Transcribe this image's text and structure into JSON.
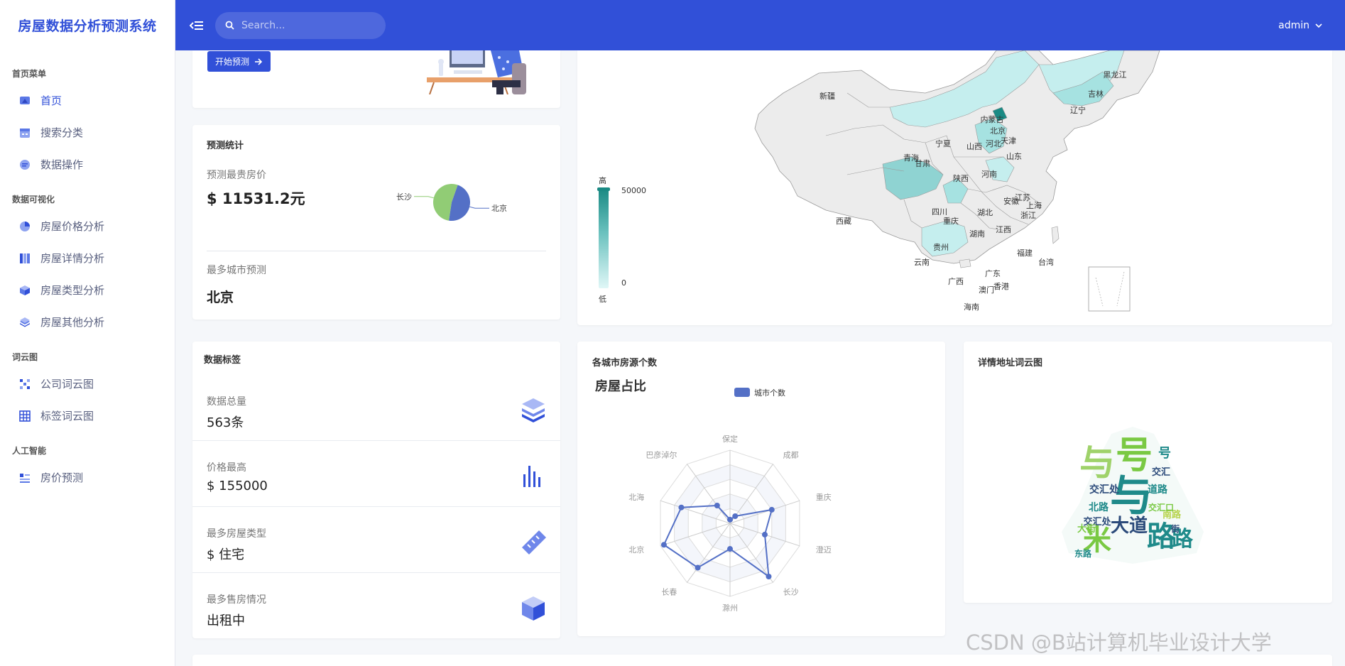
{
  "app": {
    "title": "房屋数据分析预测系统"
  },
  "search": {
    "placeholder": "Search..."
  },
  "user": {
    "name": "admin"
  },
  "sidebar": {
    "sections": [
      {
        "head": "首页菜单",
        "items": [
          {
            "label": "首页",
            "icon": "home-icon"
          },
          {
            "label": "搜索分类",
            "icon": "calendar-icon"
          },
          {
            "label": "数据操作",
            "icon": "chat-icon"
          }
        ]
      },
      {
        "head": "数据可视化",
        "items": [
          {
            "label": "房屋价格分析",
            "icon": "pie-icon"
          },
          {
            "label": "房屋详情分析",
            "icon": "columns-icon"
          },
          {
            "label": "房屋类型分析",
            "icon": "cube-icon"
          },
          {
            "label": "房屋其他分析",
            "icon": "layers-icon"
          }
        ]
      },
      {
        "head": "词云图",
        "items": [
          {
            "label": "公司词云图",
            "icon": "grid-dots-icon"
          },
          {
            "label": "标签词云图",
            "icon": "table-icon"
          }
        ]
      },
      {
        "head": "人工智能",
        "items": [
          {
            "label": "房价预测",
            "icon": "list-icon"
          }
        ]
      }
    ]
  },
  "hero": {
    "button": "开始预测"
  },
  "prediction": {
    "title": "预测统计",
    "max_price_label": "预测最贵房价",
    "max_price_value": "$ 11531.2元",
    "top_city_label": "最多城市预测",
    "top_city_value": "北京",
    "pie": {
      "labels": [
        "长沙",
        "北京"
      ],
      "values": [
        53,
        47
      ],
      "colors": [
        "#91cc75",
        "#5470c6"
      ]
    }
  },
  "map": {
    "visual_map": {
      "high": "高",
      "low": "低",
      "max": "50000",
      "min": "0"
    },
    "provinces": [
      "新疆",
      "黑龙江",
      "吉林",
      "辽宁",
      "内蒙古",
      "北京",
      "天津",
      "河北",
      "宁夏",
      "青海",
      "甘肃",
      "山西",
      "山东",
      "陕西",
      "河南",
      "江苏",
      "安徽",
      "上海",
      "四川",
      "湖北",
      "浙江",
      "重庆",
      "西藏",
      "湖南",
      "江西",
      "福建",
      "贵州",
      "云南",
      "台湾",
      "广东",
      "广西",
      "香港",
      "澳门",
      "海南"
    ]
  },
  "tags": {
    "title": "数据标签",
    "rows": [
      {
        "label": "数据总量",
        "value": "563条",
        "icon": "stack-icon"
      },
      {
        "label": "价格最高",
        "value": "$ 155000",
        "icon": "bars-icon"
      },
      {
        "label": "最多房屋类型",
        "value": "$ 住宅",
        "icon": "ruler-icon"
      },
      {
        "label": "最多售房情况",
        "value": "出租中",
        "icon": "box-icon"
      }
    ]
  },
  "radar_card": {
    "title": "各城市房源个数"
  },
  "wordcloud": {
    "title": "详情地址词云图",
    "words": [
      "号",
      "与",
      "米",
      "路",
      "大道",
      "交汇处",
      "北路",
      "交汇",
      "道路",
      "交汇处",
      "路",
      "与",
      "号",
      "大街",
      "南路",
      "东路",
      "交汇口",
      "街"
    ]
  },
  "chart_data": {
    "type": "radar",
    "title": "房屋占比",
    "legend": [
      "城市个数"
    ],
    "indicators": [
      "保定",
      "成都",
      "重庆",
      "澄迈",
      "长沙",
      "滁州",
      "长春",
      "北京",
      "北海",
      "巴彦淖尔"
    ],
    "max": 100,
    "series": [
      {
        "name": "城市个数",
        "values": [
          5,
          12,
          60,
          50,
          90,
          35,
          75,
          95,
          70,
          30
        ]
      }
    ],
    "colors": [
      "#5470c6"
    ],
    "grid": false,
    "legend_position": "top"
  },
  "watermark": "CSDN @B站计算机毕业设计大学"
}
